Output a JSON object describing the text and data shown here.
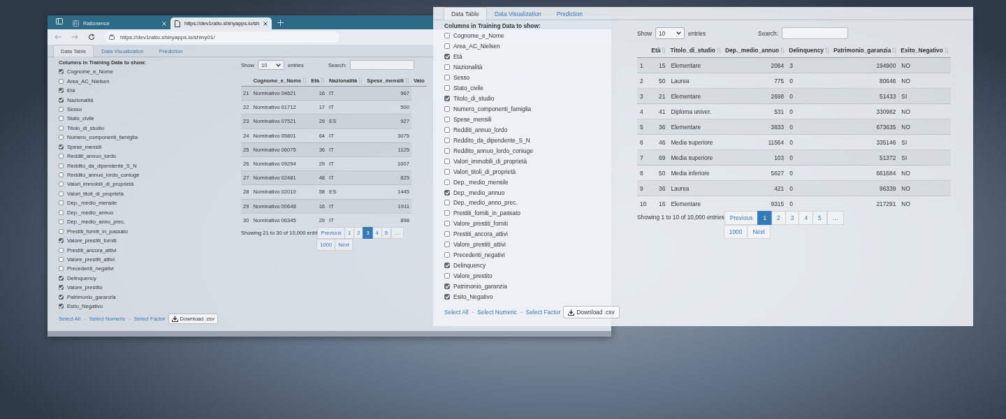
{
  "browser_window": {
    "tabs": [
      {
        "label": "Rationence",
        "selected": false
      },
      {
        "label": "https://dev1ratio.shinyapps.io/sh",
        "selected": true
      }
    ],
    "address": "https://dev1ratio.shinyapps.io/shiny01/",
    "app": {
      "tabs": [
        {
          "label": "Data Table",
          "selected": true
        },
        {
          "label": "Data Visualization",
          "selected": false
        },
        {
          "label": "Prediction",
          "selected": false
        }
      ],
      "columns_heading": "Columns in Training Data to show:",
      "columns": [
        {
          "label": "Cognome_e_Nome",
          "checked": true
        },
        {
          "label": "Area_AC_Nielsen",
          "checked": false
        },
        {
          "label": "Età",
          "checked": true
        },
        {
          "label": "Nazionalità",
          "checked": true
        },
        {
          "label": "Sesso",
          "checked": false
        },
        {
          "label": "Stato_civile",
          "checked": false
        },
        {
          "label": "Titolo_di_studio",
          "checked": false
        },
        {
          "label": "Numero_componenti_famiglia",
          "checked": false
        },
        {
          "label": "Spese_mensili",
          "checked": true
        },
        {
          "label": "Redditi_annuo_lordo",
          "checked": false
        },
        {
          "label": "Reddito_da_dipendente_S_N",
          "checked": false
        },
        {
          "label": "Reddito_annuo_lordo_coniuge",
          "checked": false
        },
        {
          "label": "Valori_immobili_di_proprietà",
          "checked": false
        },
        {
          "label": "Valori_titoli_di_proprietà",
          "checked": false
        },
        {
          "label": "Dep._medio_mensile",
          "checked": false
        },
        {
          "label": "Dep._medio_annuo",
          "checked": false
        },
        {
          "label": "Dep._medio_anno_prec.",
          "checked": false
        },
        {
          "label": "Prestiti_forniti_in_passato",
          "checked": false
        },
        {
          "label": "Valore_prestiti_forniti",
          "checked": true
        },
        {
          "label": "Prestiti_ancora_attivi",
          "checked": false
        },
        {
          "label": "Valore_prestiti_attivi",
          "checked": false
        },
        {
          "label": "Precedenti_negativi",
          "checked": false
        },
        {
          "label": "Delinquency",
          "checked": true
        },
        {
          "label": "Valore_prestito",
          "checked": true
        },
        {
          "label": "Patrimonio_garanzia",
          "checked": true
        },
        {
          "label": "Esito_Negativo",
          "checked": true
        }
      ],
      "links": [
        {
          "kind": "link",
          "text": "Select All"
        },
        {
          "kind": "separator",
          "text": "-"
        },
        {
          "kind": "link",
          "text": "Select Numeric"
        },
        {
          "kind": "separator",
          "text": "-"
        },
        {
          "kind": "link",
          "text": "Select Factor"
        }
      ],
      "download": "Download .csv",
      "length": {
        "before": "Show",
        "value": "10",
        "after": "entries"
      },
      "search_label": "Search:",
      "table": {
        "columns": [
          {
            "kind": "index"
          },
          {
            "label": "Cognome_e_Nome",
            "kind": "text",
            "sortable": true
          },
          {
            "label": "Età",
            "kind": "number",
            "sortable": true
          },
          {
            "label": "Nazionalità",
            "kind": "text",
            "sortable": true
          },
          {
            "label": "Spese_mensili",
            "kind": "number",
            "sortable": true
          },
          {
            "label": "Valo",
            "kind": "text",
            "sortable": false
          }
        ],
        "rows": [
          [
            "21",
            "Nominativo 04621",
            "16",
            "IT",
            "967"
          ],
          [
            "22",
            "Nominativo 01712",
            "17",
            "IT",
            "500"
          ],
          [
            "23",
            "Nominativo 07521",
            "29",
            "ES",
            "927"
          ],
          [
            "24",
            "Nominativo 05801",
            "64",
            "IT",
            "3075"
          ],
          [
            "25",
            "Nominativo 06075",
            "36",
            "IT",
            "1125"
          ],
          [
            "26",
            "Nominativo 09294",
            "29",
            "IT",
            "1007"
          ],
          [
            "27",
            "Nominativo 02481",
            "48",
            "IT",
            "825"
          ],
          [
            "28",
            "Nominativo 02010",
            "58",
            "ES",
            "1445"
          ],
          [
            "29",
            "Nominativo 00648",
            "16",
            "IT",
            "1911"
          ],
          [
            "30",
            "Nominativo 06345",
            "29",
            "IT",
            "898"
          ]
        ]
      },
      "info": "Showing 21 to 30 of 10,000 entri",
      "pagination": [
        {
          "label": "Previous",
          "selected": false
        },
        {
          "label": "1",
          "selected": false
        },
        {
          "label": "2",
          "selected": false
        },
        {
          "label": "3",
          "selected": true
        },
        {
          "label": "4",
          "selected": false
        },
        {
          "label": "5",
          "selected": false
        },
        {
          "label": "…",
          "selected": false
        },
        {
          "label": "1000",
          "selected": false
        },
        {
          "label": "Next",
          "selected": false
        }
      ]
    }
  },
  "front_panel": {
    "app": {
      "tabs": [
        {
          "label": "Data Table",
          "selected": true
        },
        {
          "label": "Data Visualization",
          "selected": false
        },
        {
          "label": "Prediction",
          "selected": false
        }
      ],
      "columns_heading": "Columns in Training Data to show:",
      "columns": [
        {
          "label": "Cognome_e_Nome",
          "checked": false
        },
        {
          "label": "Area_AC_Nielsen",
          "checked": false
        },
        {
          "label": "Età",
          "checked": true
        },
        {
          "label": "Nazionalità",
          "checked": false
        },
        {
          "label": "Sesso",
          "checked": false
        },
        {
          "label": "Stato_civile",
          "checked": false
        },
        {
          "label": "Titolo_di_studio",
          "checked": true
        },
        {
          "label": "Numero_componenti_famiglia",
          "checked": false
        },
        {
          "label": "Spese_mensili",
          "checked": false
        },
        {
          "label": "Redditi_annuo_lordo",
          "checked": false
        },
        {
          "label": "Reddito_da_dipendente_S_N",
          "checked": false
        },
        {
          "label": "Reddito_annuo_lordo_coniuge",
          "checked": false
        },
        {
          "label": "Valori_immobili_di_proprietà",
          "checked": false
        },
        {
          "label": "Valori_titoli_di_proprietà",
          "checked": false
        },
        {
          "label": "Dep._medio_mensile",
          "checked": false
        },
        {
          "label": "Dep._medio_annuo",
          "checked": true
        },
        {
          "label": "Dep._medio_anno_prec.",
          "checked": false
        },
        {
          "label": "Prestiti_forniti_in_passato",
          "checked": false
        },
        {
          "label": "Valore_prestiti_forniti",
          "checked": false
        },
        {
          "label": "Prestiti_ancora_attivi",
          "checked": false
        },
        {
          "label": "Valore_prestiti_attivi",
          "checked": false
        },
        {
          "label": "Precedenti_negativi",
          "checked": false
        },
        {
          "label": "Delinquency",
          "checked": true
        },
        {
          "label": "Valore_prestito",
          "checked": false
        },
        {
          "label": "Patrimonio_garanzia",
          "checked": true
        },
        {
          "label": "Esito_Negativo",
          "checked": true
        }
      ],
      "links": [
        {
          "kind": "link",
          "text": "Select All"
        },
        {
          "kind": "separator",
          "text": "-"
        },
        {
          "kind": "link",
          "text": "Select Numeric"
        },
        {
          "kind": "separator",
          "text": "-"
        },
        {
          "kind": "link",
          "text": "Select Factor"
        }
      ],
      "download": "Download .csv",
      "length": {
        "before": "Show",
        "value": "10",
        "after": "entries"
      },
      "search_label": "Search:",
      "table": {
        "columns": [
          {
            "kind": "index"
          },
          {
            "label": "Età",
            "kind": "number",
            "sortable": true
          },
          {
            "label": "Titolo_di_studio",
            "kind": "text",
            "sortable": true
          },
          {
            "label": "Dep._medio_annuo",
            "kind": "number",
            "sortable": true
          },
          {
            "label": "Delinquency",
            "kind": "text",
            "sortable": true
          },
          {
            "label": "Patrimonio_garanzia",
            "kind": "number",
            "sortable": true
          },
          {
            "label": "Esito_Negativo",
            "kind": "text",
            "sortable": true
          }
        ],
        "rows": [
          [
            "1",
            "15",
            "Elementare",
            "2084",
            "3",
            "194900",
            "NO"
          ],
          [
            "2",
            "50",
            "Laurea",
            "775",
            "0",
            "80646",
            "NO"
          ],
          [
            "3",
            "21",
            "Elementare",
            "2698",
            "0",
            "51433",
            "SI"
          ],
          [
            "4",
            "41",
            "Diploma univer.",
            "531",
            "0",
            "330982",
            "NO"
          ],
          [
            "5",
            "36",
            "Elementare",
            "3833",
            "0",
            "673635",
            "NO"
          ],
          [
            "6",
            "46",
            "Media superiore",
            "11564",
            "0",
            "335146",
            "SI"
          ],
          [
            "7",
            "69",
            "Media superiore",
            "103",
            "0",
            "51372",
            "SI"
          ],
          [
            "8",
            "50",
            "Media inferiore",
            "5627",
            "0",
            "661684",
            "NO"
          ],
          [
            "9",
            "36",
            "Laurea",
            "421",
            "0",
            "96339",
            "NO"
          ],
          [
            "10",
            "16",
            "Elementare",
            "9315",
            "0",
            "217291",
            "NO"
          ]
        ]
      },
      "info": "Showing 1 to 10 of 10,000 entries",
      "pagination": [
        {
          "label": "Previous",
          "selected": false
        },
        {
          "label": "1",
          "selected": true
        },
        {
          "label": "2",
          "selected": false
        },
        {
          "label": "3",
          "selected": false
        },
        {
          "label": "4",
          "selected": false
        },
        {
          "label": "5",
          "selected": false
        },
        {
          "label": "…",
          "selected": false
        },
        {
          "label": "1000",
          "selected": false
        },
        {
          "label": "Next",
          "selected": false
        }
      ]
    }
  }
}
